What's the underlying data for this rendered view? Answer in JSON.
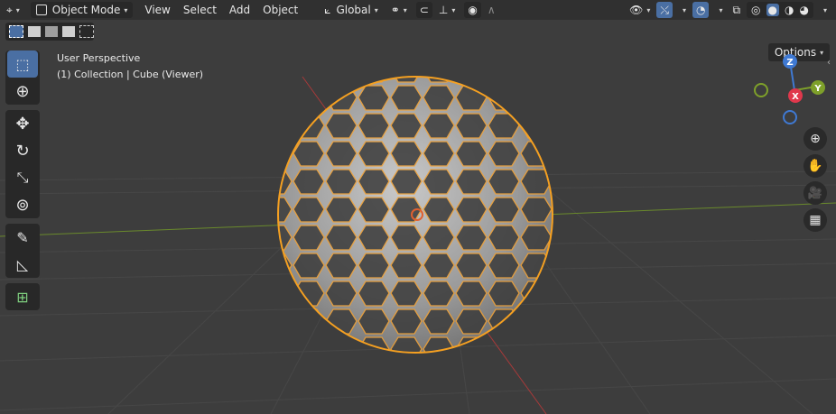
{
  "header": {
    "mode": "Object Mode",
    "menus": [
      "View",
      "Select",
      "Add",
      "Object"
    ],
    "transform_orientation": "Global",
    "options_label": "Options"
  },
  "viewport": {
    "perspective_label": "User Perspective",
    "collection_label": "(1) Collection | Cube (Viewer)"
  },
  "gizmo": {
    "x_label": "X",
    "y_label": "Y",
    "z_label": "Z"
  },
  "colors": {
    "accent": "#4a6fa3",
    "selection": "#f5a021",
    "x_axis": "#e0384c",
    "y_axis": "#7ea02a",
    "z_axis": "#3f79d3"
  }
}
